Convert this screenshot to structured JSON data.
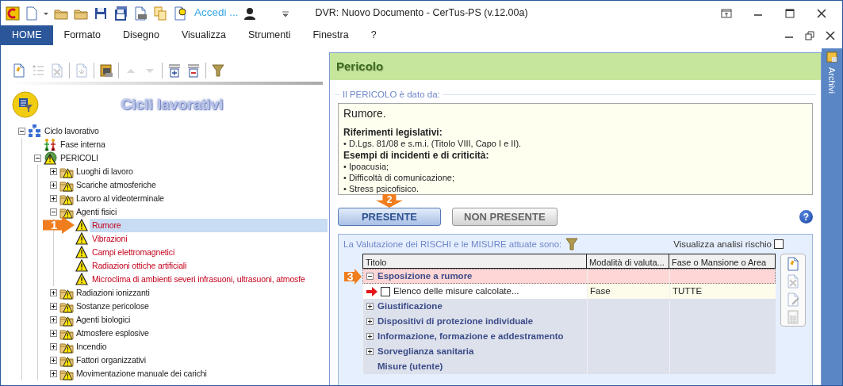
{
  "title_bar": {
    "login": "Accedi ...",
    "title": "DVR: Nuovo Documento - CerTus-PS (v.12.00a)"
  },
  "ribbon_tabs": [
    {
      "label": "HOME",
      "selected": true
    },
    {
      "label": "Formato",
      "selected": false
    },
    {
      "label": "Disegno",
      "selected": false
    },
    {
      "label": "Visualizza",
      "selected": false
    },
    {
      "label": "Strumenti",
      "selected": false
    },
    {
      "label": "Finestra",
      "selected": false
    },
    {
      "label": "?",
      "selected": false
    }
  ],
  "left_panel": {
    "title": "Cicli lavorativi",
    "toolbar": [
      {
        "kind": "new",
        "disabled": false
      },
      {
        "kind": "add-list",
        "disabled": true
      },
      {
        "kind": "delete",
        "disabled": true
      },
      {
        "kind": "sep"
      },
      {
        "kind": "import",
        "disabled": true
      },
      {
        "kind": "sep"
      },
      {
        "kind": "archive",
        "disabled": false
      },
      {
        "kind": "sep"
      },
      {
        "kind": "up",
        "disabled": true
      },
      {
        "kind": "down",
        "disabled": true
      },
      {
        "kind": "sep"
      },
      {
        "kind": "expand-all",
        "disabled": false
      },
      {
        "kind": "collapse-all",
        "disabled": false
      },
      {
        "kind": "sep"
      },
      {
        "kind": "filter",
        "disabled": false
      }
    ],
    "tree": [
      {
        "label": "Ciclo lavorativo",
        "kind": "cycle",
        "expanded": true,
        "selected": false,
        "children": [
          {
            "label": "Fase interna",
            "kind": "phase",
            "selected": false
          },
          {
            "label": "PERICOLI",
            "kind": "hazards",
            "expanded": true,
            "selected": false,
            "children": [
              {
                "label": "Luoghi di lavoro",
                "kind": "category",
                "expanded": false,
                "selected": false
              },
              {
                "label": "Scariche atmosferiche",
                "kind": "category",
                "expanded": false,
                "selected": false
              },
              {
                "label": "Lavoro al videoterminale",
                "kind": "category",
                "expanded": false,
                "selected": false
              },
              {
                "label": "Agenti fisici",
                "kind": "category",
                "expanded": true,
                "selected": false,
                "children": [
                  {
                    "label": "Rumore",
                    "kind": "hazard",
                    "selected": true,
                    "callout": "1"
                  },
                  {
                    "label": "Vibrazioni",
                    "kind": "hazard",
                    "selected": false
                  },
                  {
                    "label": "Campi elettromagnetici",
                    "kind": "hazard",
                    "selected": false
                  },
                  {
                    "label": "Radiazioni ottiche artificiali",
                    "kind": "hazard",
                    "selected": false
                  },
                  {
                    "label": "Microclima di ambienti severi infrasuoni, ultrasuoni, atmosfe",
                    "kind": "hazard",
                    "selected": false
                  }
                ]
              },
              {
                "label": "Radiazioni ionizzanti",
                "kind": "category",
                "expanded": false,
                "selected": false
              },
              {
                "label": "Sostanze pericolose",
                "kind": "category",
                "expanded": false,
                "selected": false
              },
              {
                "label": "Agenti biologici",
                "kind": "category",
                "expanded": false,
                "selected": false
              },
              {
                "label": "Atmosfere esplosive",
                "kind": "category",
                "expanded": false,
                "selected": false
              },
              {
                "label": "Incendio",
                "kind": "category",
                "expanded": false,
                "selected": false
              },
              {
                "label": "Fattori organizzativi",
                "kind": "category",
                "expanded": false,
                "selected": false
              },
              {
                "label": "Movimentazione manuale dei carichi",
                "kind": "category",
                "expanded": false,
                "selected": false
              }
            ]
          }
        ]
      }
    ]
  },
  "detail": {
    "title": "Pericolo",
    "legend": "Il PERICOLO è dato da:",
    "description": {
      "lead": "Rumore.",
      "sections": [
        {
          "heading": "Riferimenti legislativi:",
          "items": [
            "•  D.Lgs. 81/08 e s.m.i. (Titolo VIII, Capo I e II)."
          ]
        },
        {
          "heading": "Esempi di incidenti e di criticità:",
          "items": [
            "•  Ipoacusia;",
            "•  Difficoltà di comunicazione;",
            "•  Stress psicofisico."
          ]
        }
      ]
    },
    "buttons": [
      {
        "label": "PRESENTE",
        "selected": true,
        "callout": "2"
      },
      {
        "label": "NON PRESENTE",
        "selected": false
      }
    ],
    "help": "?",
    "evaluation": {
      "legend": "La Valutazione dei RISCHI e le MISURE attuate sono:",
      "toggle": {
        "label": "Visualizza analisi rischio",
        "checked": false
      },
      "columns": [
        "Titolo",
        "Modalità di valuta...",
        "Fase o Mansione o Area"
      ],
      "rows": [
        {
          "title": "Esposizione a rumore",
          "kind": "group",
          "expanded": true,
          "selected": true,
          "callout": "3",
          "children": [
            {
              "title": "Elenco delle misure calcolate...",
              "kind": "item",
              "checked": false,
              "selected": false,
              "pointer": true,
              "mode": "Fase",
              "scope": "TUTTE"
            }
          ]
        },
        {
          "title": "Giustificazione",
          "kind": "group",
          "expanded": false,
          "selected": false
        },
        {
          "title": "Dispositivi di protezione individuale",
          "kind": "group",
          "expanded": false,
          "selected": false
        },
        {
          "title": "Informazione, formazione e addestramento",
          "kind": "group",
          "expanded": false,
          "selected": false
        },
        {
          "title": "Sorveglianza sanitaria",
          "kind": "group",
          "expanded": false,
          "selected": false
        },
        {
          "title": "Misure (utente)",
          "kind": "group",
          "selected": false
        }
      ],
      "tools": [
        {
          "kind": "new",
          "disabled": false
        },
        {
          "kind": "delete",
          "disabled": true
        },
        {
          "kind": "edit",
          "disabled": true
        },
        {
          "kind": "calc",
          "disabled": true
        }
      ]
    }
  },
  "side_panel": {
    "label": "Archivi"
  }
}
